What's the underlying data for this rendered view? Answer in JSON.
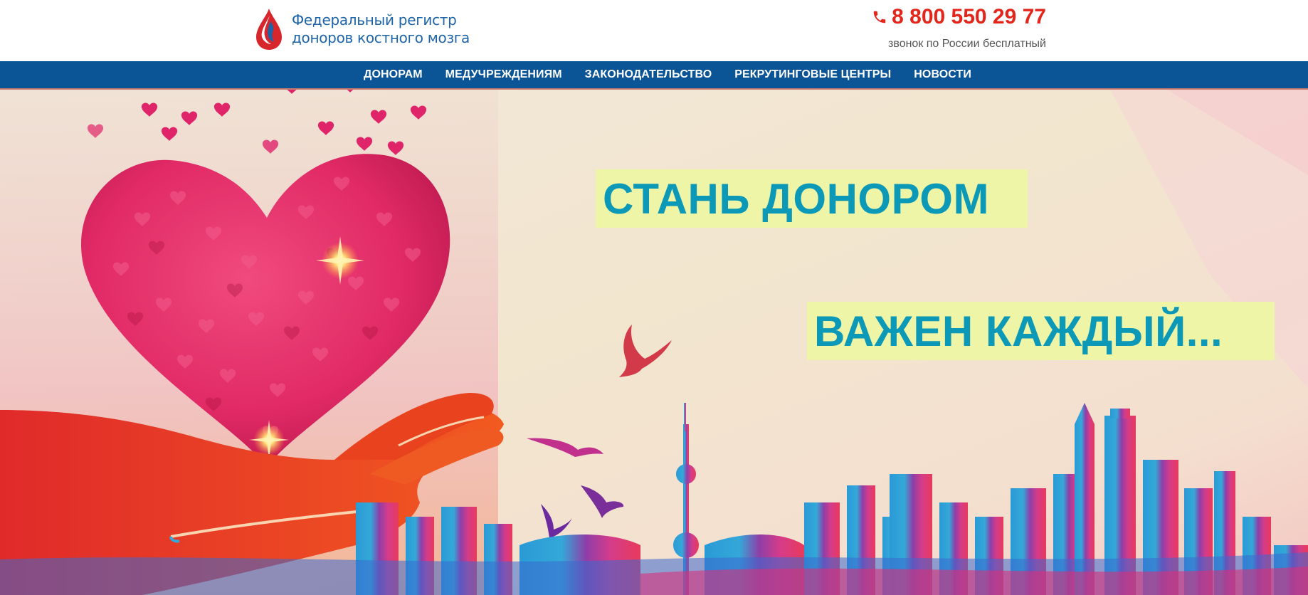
{
  "header": {
    "logo": {
      "line1": "Федеральный регистр",
      "line2": "доноров костного мозга",
      "icon": "blood-drop-face-logo"
    },
    "phone": {
      "number": "8 800 550 29 77",
      "note": "звонок по России бесплатный",
      "icon": "phone-icon",
      "color": "#e2261c"
    }
  },
  "nav": {
    "background": "#0b5597",
    "items": [
      {
        "label": "ДОНОРАМ"
      },
      {
        "label": "МЕДУЧРЕЖДЕНИЯМ"
      },
      {
        "label": "ЗАКОНОДАТЕЛЬСТВО"
      },
      {
        "label": "РЕКРУТИНГОВЫЕ ЦЕНТРЫ"
      },
      {
        "label": "НОВОСТИ"
      }
    ]
  },
  "hero": {
    "slogan_line1": "СТАНЬ ДОНОРОМ",
    "slogan_line2": "ВАЖЕН КАЖДЫЙ...",
    "slogan_color": "#0c98b7",
    "slogan_highlight": "#eef5a6",
    "illustration": "hand-holding-heart-of-hearts-city-skyline"
  }
}
